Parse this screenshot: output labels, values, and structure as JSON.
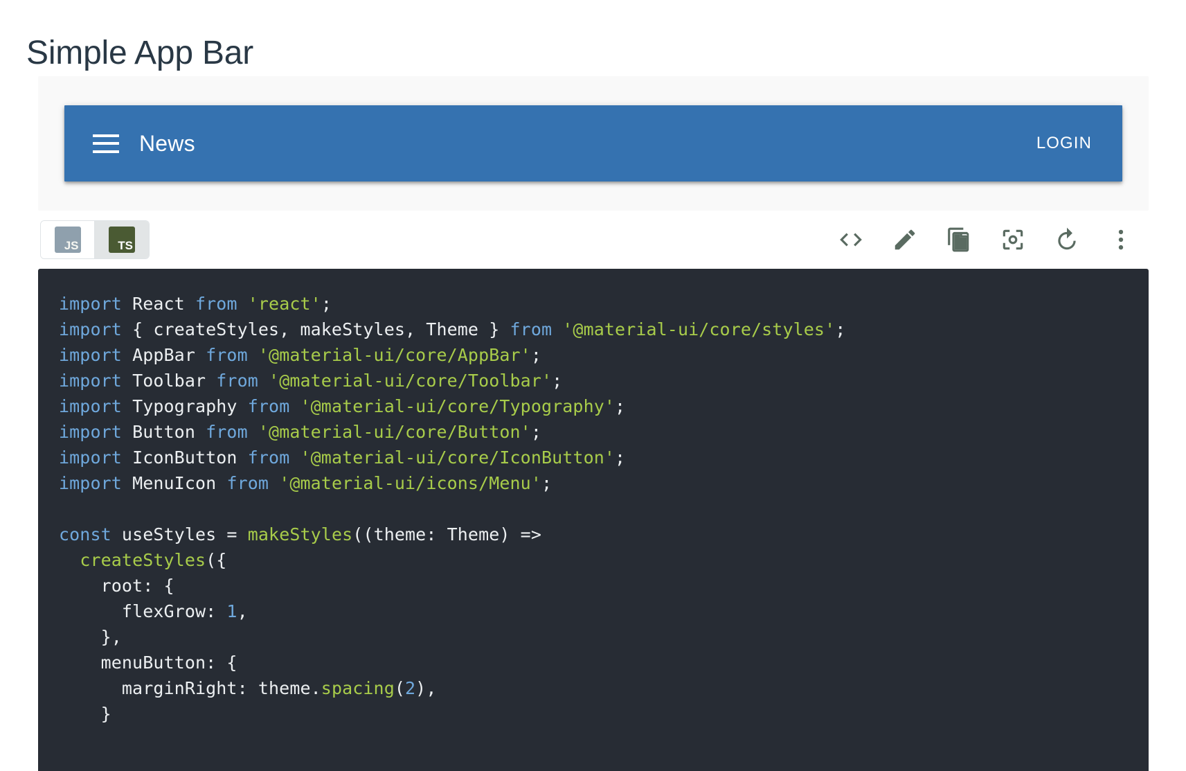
{
  "page": {
    "title": "Simple App Bar"
  },
  "demo": {
    "appbar": {
      "menu_icon": "hamburger-menu-icon",
      "title": "News",
      "login_label": "LOGIN",
      "background_color": "#3572b0",
      "text_color": "#ffffff"
    },
    "container_background": "#f9f9f9"
  },
  "toolbar": {
    "language_toggle": {
      "options": [
        {
          "id": "js",
          "label": "JS",
          "selected": false,
          "glyph_color": "#8fa0ad"
        },
        {
          "id": "ts",
          "label": "TS",
          "selected": true,
          "glyph_color": "#4a5a33"
        }
      ]
    },
    "actions": [
      {
        "id": "show-source",
        "icon": "code-brackets-icon",
        "label": "Show source"
      },
      {
        "id": "edit-codesandbox",
        "icon": "pencil-edit-icon",
        "label": "Edit in CodeSandbox"
      },
      {
        "id": "copy",
        "icon": "copy-document-icon",
        "label": "Copy the source"
      },
      {
        "id": "focus",
        "icon": "center-focus-icon",
        "label": "Toggle RTL / focus"
      },
      {
        "id": "reset",
        "icon": "refresh-reset-icon",
        "label": "Reset demo"
      },
      {
        "id": "more",
        "icon": "more-vert-icon",
        "label": "More options"
      }
    ],
    "icon_color": "#5a6b61"
  },
  "code": {
    "language": "tsx",
    "background_color": "#272c34",
    "lines": [
      [
        {
          "t": "import ",
          "c": "kw"
        },
        {
          "t": "React ",
          "c": "pln"
        },
        {
          "t": "from ",
          "c": "kw"
        },
        {
          "t": "'react'",
          "c": "str"
        },
        {
          "t": ";",
          "c": "pln"
        }
      ],
      [
        {
          "t": "import ",
          "c": "kw"
        },
        {
          "t": "{ createStyles, makeStyles, Theme } ",
          "c": "pln"
        },
        {
          "t": "from ",
          "c": "kw"
        },
        {
          "t": "'@material-ui/core/styles'",
          "c": "str"
        },
        {
          "t": ";",
          "c": "pln"
        }
      ],
      [
        {
          "t": "import ",
          "c": "kw"
        },
        {
          "t": "AppBar ",
          "c": "pln"
        },
        {
          "t": "from ",
          "c": "kw"
        },
        {
          "t": "'@material-ui/core/AppBar'",
          "c": "str"
        },
        {
          "t": ";",
          "c": "pln"
        }
      ],
      [
        {
          "t": "import ",
          "c": "kw"
        },
        {
          "t": "Toolbar ",
          "c": "pln"
        },
        {
          "t": "from ",
          "c": "kw"
        },
        {
          "t": "'@material-ui/core/Toolbar'",
          "c": "str"
        },
        {
          "t": ";",
          "c": "pln"
        }
      ],
      [
        {
          "t": "import ",
          "c": "kw"
        },
        {
          "t": "Typography ",
          "c": "pln"
        },
        {
          "t": "from ",
          "c": "kw"
        },
        {
          "t": "'@material-ui/core/Typography'",
          "c": "str"
        },
        {
          "t": ";",
          "c": "pln"
        }
      ],
      [
        {
          "t": "import ",
          "c": "kw"
        },
        {
          "t": "Button ",
          "c": "pln"
        },
        {
          "t": "from ",
          "c": "kw"
        },
        {
          "t": "'@material-ui/core/Button'",
          "c": "str"
        },
        {
          "t": ";",
          "c": "pln"
        }
      ],
      [
        {
          "t": "import ",
          "c": "kw"
        },
        {
          "t": "IconButton ",
          "c": "pln"
        },
        {
          "t": "from ",
          "c": "kw"
        },
        {
          "t": "'@material-ui/core/IconButton'",
          "c": "str"
        },
        {
          "t": ";",
          "c": "pln"
        }
      ],
      [
        {
          "t": "import ",
          "c": "kw"
        },
        {
          "t": "MenuIcon ",
          "c": "pln"
        },
        {
          "t": "from ",
          "c": "kw"
        },
        {
          "t": "'@material-ui/icons/Menu'",
          "c": "str"
        },
        {
          "t": ";",
          "c": "pln"
        }
      ],
      [],
      [
        {
          "t": "const ",
          "c": "kw"
        },
        {
          "t": "useStyles = ",
          "c": "pln"
        },
        {
          "t": "makeStyles",
          "c": "fn"
        },
        {
          "t": "((theme: Theme) =>",
          "c": "pln"
        }
      ],
      [
        {
          "t": "  ",
          "c": "pln"
        },
        {
          "t": "createStyles",
          "c": "fn"
        },
        {
          "t": "({",
          "c": "pln"
        }
      ],
      [
        {
          "t": "    root: {",
          "c": "pln"
        }
      ],
      [
        {
          "t": "      flexGrow: ",
          "c": "pln"
        },
        {
          "t": "1",
          "c": "num"
        },
        {
          "t": ",",
          "c": "pln"
        }
      ],
      [
        {
          "t": "    },",
          "c": "pln"
        }
      ],
      [
        {
          "t": "    menuButton: {",
          "c": "pln"
        }
      ],
      [
        {
          "t": "      marginRight: theme.",
          "c": "pln"
        },
        {
          "t": "spacing",
          "c": "fn"
        },
        {
          "t": "(",
          "c": "pln"
        },
        {
          "t": "2",
          "c": "num"
        },
        {
          "t": "),",
          "c": "pln"
        }
      ],
      [
        {
          "t": "    }",
          "c": "pln"
        }
      ]
    ]
  }
}
